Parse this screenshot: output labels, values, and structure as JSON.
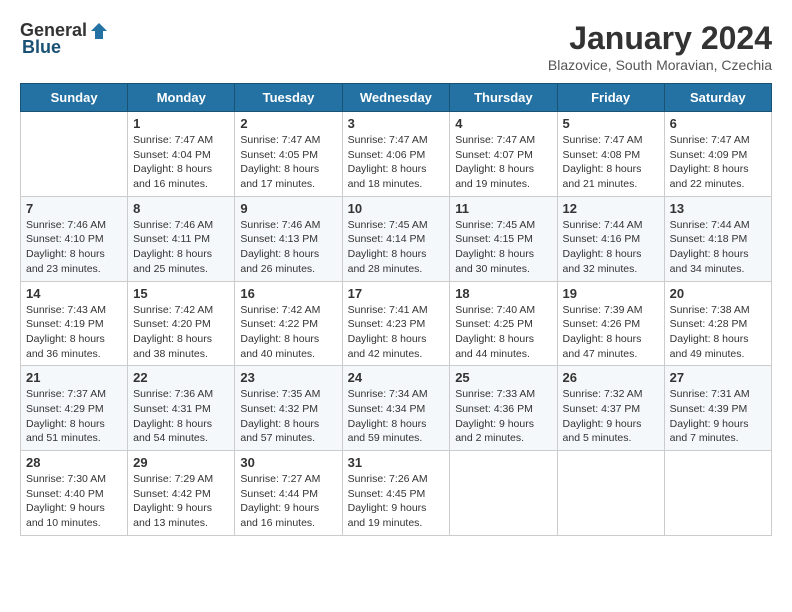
{
  "header": {
    "logo_general": "General",
    "logo_blue": "Blue",
    "month_title": "January 2024",
    "subtitle": "Blazovice, South Moravian, Czechia"
  },
  "weekdays": [
    "Sunday",
    "Monday",
    "Tuesday",
    "Wednesday",
    "Thursday",
    "Friday",
    "Saturday"
  ],
  "weeks": [
    [
      {
        "day": "",
        "info": ""
      },
      {
        "day": "1",
        "info": "Sunrise: 7:47 AM\nSunset: 4:04 PM\nDaylight: 8 hours\nand 16 minutes."
      },
      {
        "day": "2",
        "info": "Sunrise: 7:47 AM\nSunset: 4:05 PM\nDaylight: 8 hours\nand 17 minutes."
      },
      {
        "day": "3",
        "info": "Sunrise: 7:47 AM\nSunset: 4:06 PM\nDaylight: 8 hours\nand 18 minutes."
      },
      {
        "day": "4",
        "info": "Sunrise: 7:47 AM\nSunset: 4:07 PM\nDaylight: 8 hours\nand 19 minutes."
      },
      {
        "day": "5",
        "info": "Sunrise: 7:47 AM\nSunset: 4:08 PM\nDaylight: 8 hours\nand 21 minutes."
      },
      {
        "day": "6",
        "info": "Sunrise: 7:47 AM\nSunset: 4:09 PM\nDaylight: 8 hours\nand 22 minutes."
      }
    ],
    [
      {
        "day": "7",
        "info": "Sunrise: 7:46 AM\nSunset: 4:10 PM\nDaylight: 8 hours\nand 23 minutes."
      },
      {
        "day": "8",
        "info": "Sunrise: 7:46 AM\nSunset: 4:11 PM\nDaylight: 8 hours\nand 25 minutes."
      },
      {
        "day": "9",
        "info": "Sunrise: 7:46 AM\nSunset: 4:13 PM\nDaylight: 8 hours\nand 26 minutes."
      },
      {
        "day": "10",
        "info": "Sunrise: 7:45 AM\nSunset: 4:14 PM\nDaylight: 8 hours\nand 28 minutes."
      },
      {
        "day": "11",
        "info": "Sunrise: 7:45 AM\nSunset: 4:15 PM\nDaylight: 8 hours\nand 30 minutes."
      },
      {
        "day": "12",
        "info": "Sunrise: 7:44 AM\nSunset: 4:16 PM\nDaylight: 8 hours\nand 32 minutes."
      },
      {
        "day": "13",
        "info": "Sunrise: 7:44 AM\nSunset: 4:18 PM\nDaylight: 8 hours\nand 34 minutes."
      }
    ],
    [
      {
        "day": "14",
        "info": "Sunrise: 7:43 AM\nSunset: 4:19 PM\nDaylight: 8 hours\nand 36 minutes."
      },
      {
        "day": "15",
        "info": "Sunrise: 7:42 AM\nSunset: 4:20 PM\nDaylight: 8 hours\nand 38 minutes."
      },
      {
        "day": "16",
        "info": "Sunrise: 7:42 AM\nSunset: 4:22 PM\nDaylight: 8 hours\nand 40 minutes."
      },
      {
        "day": "17",
        "info": "Sunrise: 7:41 AM\nSunset: 4:23 PM\nDaylight: 8 hours\nand 42 minutes."
      },
      {
        "day": "18",
        "info": "Sunrise: 7:40 AM\nSunset: 4:25 PM\nDaylight: 8 hours\nand 44 minutes."
      },
      {
        "day": "19",
        "info": "Sunrise: 7:39 AM\nSunset: 4:26 PM\nDaylight: 8 hours\nand 47 minutes."
      },
      {
        "day": "20",
        "info": "Sunrise: 7:38 AM\nSunset: 4:28 PM\nDaylight: 8 hours\nand 49 minutes."
      }
    ],
    [
      {
        "day": "21",
        "info": "Sunrise: 7:37 AM\nSunset: 4:29 PM\nDaylight: 8 hours\nand 51 minutes."
      },
      {
        "day": "22",
        "info": "Sunrise: 7:36 AM\nSunset: 4:31 PM\nDaylight: 8 hours\nand 54 minutes."
      },
      {
        "day": "23",
        "info": "Sunrise: 7:35 AM\nSunset: 4:32 PM\nDaylight: 8 hours\nand 57 minutes."
      },
      {
        "day": "24",
        "info": "Sunrise: 7:34 AM\nSunset: 4:34 PM\nDaylight: 8 hours\nand 59 minutes."
      },
      {
        "day": "25",
        "info": "Sunrise: 7:33 AM\nSunset: 4:36 PM\nDaylight: 9 hours\nand 2 minutes."
      },
      {
        "day": "26",
        "info": "Sunrise: 7:32 AM\nSunset: 4:37 PM\nDaylight: 9 hours\nand 5 minutes."
      },
      {
        "day": "27",
        "info": "Sunrise: 7:31 AM\nSunset: 4:39 PM\nDaylight: 9 hours\nand 7 minutes."
      }
    ],
    [
      {
        "day": "28",
        "info": "Sunrise: 7:30 AM\nSunset: 4:40 PM\nDaylight: 9 hours\nand 10 minutes."
      },
      {
        "day": "29",
        "info": "Sunrise: 7:29 AM\nSunset: 4:42 PM\nDaylight: 9 hours\nand 13 minutes."
      },
      {
        "day": "30",
        "info": "Sunrise: 7:27 AM\nSunset: 4:44 PM\nDaylight: 9 hours\nand 16 minutes."
      },
      {
        "day": "31",
        "info": "Sunrise: 7:26 AM\nSunset: 4:45 PM\nDaylight: 9 hours\nand 19 minutes."
      },
      {
        "day": "",
        "info": ""
      },
      {
        "day": "",
        "info": ""
      },
      {
        "day": "",
        "info": ""
      }
    ]
  ]
}
